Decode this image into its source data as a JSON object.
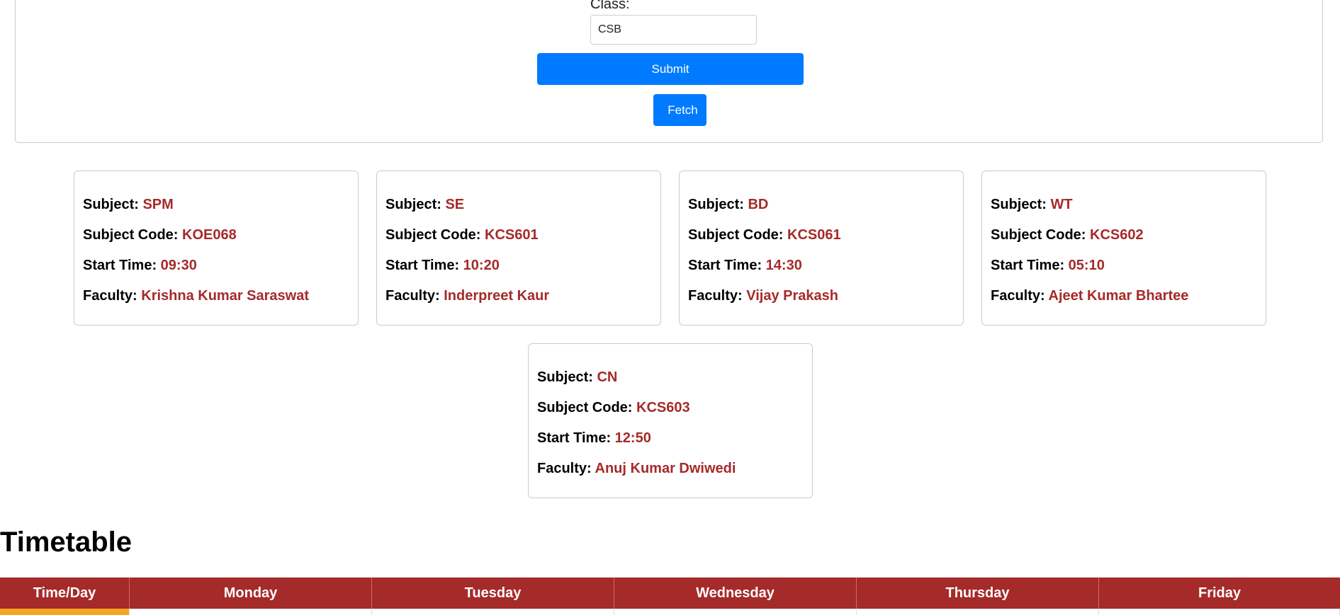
{
  "form": {
    "class_label": "Class:",
    "class_value": "CSB",
    "submit_label": "Submit",
    "fetch_label": "Fetch"
  },
  "cards": [
    {
      "subject_label": "Subject:",
      "subject": "SPM",
      "code_label": "Subject Code:",
      "code": "KOE068",
      "time_label": "Start Time:",
      "time": "09:30",
      "faculty_label": "Faculty:",
      "faculty": "Krishna Kumar Saraswat"
    },
    {
      "subject_label": "Subject:",
      "subject": "SE",
      "code_label": "Subject Code:",
      "code": "KCS601",
      "time_label": "Start Time:",
      "time": "10:20",
      "faculty_label": "Faculty:",
      "faculty": "Inderpreet Kaur"
    },
    {
      "subject_label": "Subject:",
      "subject": "BD",
      "code_label": "Subject Code:",
      "code": "KCS061",
      "time_label": "Start Time:",
      "time": "14:30",
      "faculty_label": "Faculty:",
      "faculty": "Vijay Prakash"
    },
    {
      "subject_label": "Subject:",
      "subject": "WT",
      "code_label": "Subject Code:",
      "code": "KCS602",
      "time_label": "Start Time:",
      "time": "05:10",
      "faculty_label": "Faculty:",
      "faculty": "Ajeet Kumar Bhartee"
    },
    {
      "subject_label": "Subject:",
      "subject": "CN",
      "code_label": "Subject Code:",
      "code": "KCS603",
      "time_label": "Start Time:",
      "time": "12:50",
      "faculty_label": "Faculty:",
      "faculty": "Anuj Kumar Dwiwedi"
    }
  ],
  "timetable": {
    "title": "Timetable",
    "headers": [
      "Time/Day",
      "Monday",
      "Tuesday",
      "Wednesday",
      "Thursday",
      "Friday"
    ]
  },
  "colors": {
    "accent": "#007bff",
    "value_text": "#a52a2a",
    "table_header": "#a52a2a",
    "time_cell": "#f5a623"
  }
}
